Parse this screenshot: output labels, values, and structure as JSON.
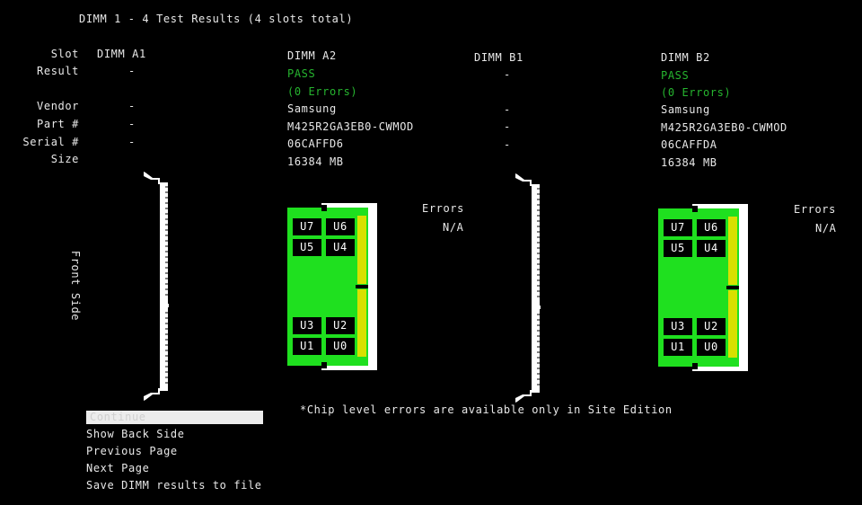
{
  "title": "DIMM 1 - 4 Test Results (4 slots total)",
  "labels": {
    "slot": "Slot",
    "result": "Result",
    "vendor": "Vendor",
    "part": "Part #",
    "serial": "Serial #",
    "size": "Size"
  },
  "side_label": "Front Side",
  "slots": [
    {
      "name": "DIMM A1",
      "result": "-",
      "errors_text": "",
      "vendor": "-",
      "part": "-",
      "serial": "-",
      "size": "",
      "populated": false
    },
    {
      "name": "DIMM A2",
      "result": "PASS",
      "errors_text": "(0 Errors)",
      "vendor": "Samsung",
      "part": "M425R2GA3EB0-CWMOD",
      "serial": "06CAFFD6",
      "size": "16384 MB",
      "populated": true,
      "errors_heading": "Errors",
      "errors_value": "N/A"
    },
    {
      "name": "DIMM B1",
      "result": "-",
      "errors_text": "",
      "vendor": "-",
      "part": "-",
      "serial": "-",
      "size": "",
      "populated": false
    },
    {
      "name": "DIMM B2",
      "result": "PASS",
      "errors_text": "(0 Errors)",
      "vendor": "Samsung",
      "part": "M425R2GA3EB0-CWMOD",
      "serial": "06CAFFDA",
      "size": "16384 MB",
      "populated": true,
      "errors_heading": "Errors",
      "errors_value": "N/A"
    }
  ],
  "chips": [
    "U7",
    "U6",
    "U5",
    "U4",
    "U3",
    "U2",
    "U1",
    "U0"
  ],
  "note": "*Chip level errors are available only in Site Edition",
  "menu": {
    "continue": "Continue",
    "back_side": "Show Back Side",
    "previous": "Previous Page",
    "next": "Next Page",
    "save": "Save DIMM results to file"
  },
  "colors": {
    "pass": "#26b52f",
    "pcb": "#1fe01f",
    "contacts": "#d8e000",
    "background": "#000000"
  }
}
